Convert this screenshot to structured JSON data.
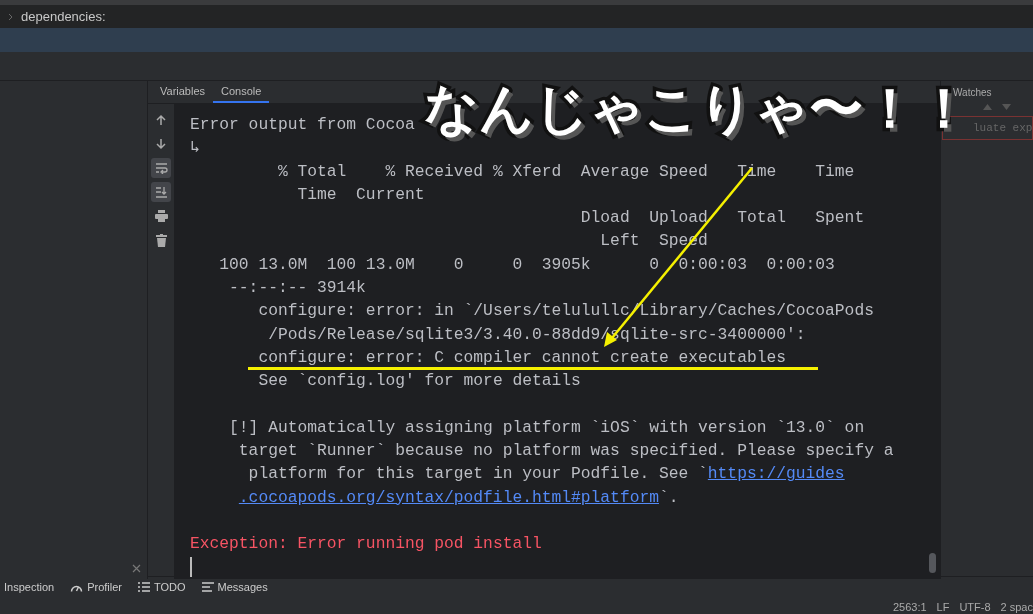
{
  "editor": {
    "breadcrumb": "dependencies:"
  },
  "debug_tabs": [
    {
      "label": "Variables",
      "selected": false
    },
    {
      "label": "Console",
      "selected": true
    }
  ],
  "console_tools": [
    {
      "kind": "up",
      "on": false
    },
    {
      "kind": "down",
      "on": false
    },
    {
      "kind": "wrap",
      "on": true
    },
    {
      "kind": "scroll",
      "on": true
    },
    {
      "kind": "print",
      "on": false
    },
    {
      "kind": "trash",
      "on": false
    }
  ],
  "console_lines": [
    {
      "kind": "plain",
      "text": "Error output from Cocoa"
    },
    {
      "kind": "plain",
      "text": "↳"
    },
    {
      "kind": "plain",
      "text": "         % Total    % Received % Xferd  Average Speed   Time    Time"
    },
    {
      "kind": "plain",
      "text": "           Time  Current"
    },
    {
      "kind": "plain",
      "text": "                                        Dload  Upload   Total   Spent"
    },
    {
      "kind": "plain",
      "text": "                                          Left  Speed"
    },
    {
      "kind": "plain",
      "text": "   100 13.0M  100 13.0M    0     0  3905k      0  0:00:03  0:00:03"
    },
    {
      "kind": "plain",
      "text": "    --:--:-- 3914k"
    },
    {
      "kind": "plain",
      "text": "       configure: error: in `/Users/telulullc/Library/Caches/CocoaPods"
    },
    {
      "kind": "plain",
      "text": "        /Pods/Release/sqlite3/3.40.0-88dd9/sqlite-src-3400000':"
    },
    {
      "kind": "plain",
      "text": "       configure: error: C compiler cannot create executables"
    },
    {
      "kind": "plain",
      "text": "       See `config.log' for more details"
    },
    {
      "kind": "blank"
    },
    {
      "kind": "plain",
      "text": "    [!] Automatically assigning platform `iOS` with version `13.0` on"
    },
    {
      "kind": "plain",
      "text": "     target `Runner` because no platform was specified. Please specify a"
    },
    {
      "kind": "link",
      "before": "      platform for this target in your Podfile. See `",
      "link": "https://guides"
    },
    {
      "kind": "link",
      "link": ".cocoapods.org/syntax/podfile.html#platform",
      "after": "`."
    },
    {
      "kind": "blank"
    },
    {
      "kind": "error",
      "text": "Exception: Error running pod install"
    },
    {
      "kind": "cursor"
    }
  ],
  "watches": {
    "title": "Watches",
    "field_text": "luate exp"
  },
  "tool_windows": [
    {
      "kind": "none",
      "label": "Inspection"
    },
    {
      "kind": "gauge",
      "label": "Profiler"
    },
    {
      "kind": "list",
      "label": "TODO"
    },
    {
      "kind": "lines",
      "label": "Messages"
    }
  ],
  "status_bar": [
    "2563:1",
    "LF",
    "UTF-8",
    "2 spac"
  ],
  "annotation": {
    "caption": "なんじゃこりゃ〜！！"
  }
}
